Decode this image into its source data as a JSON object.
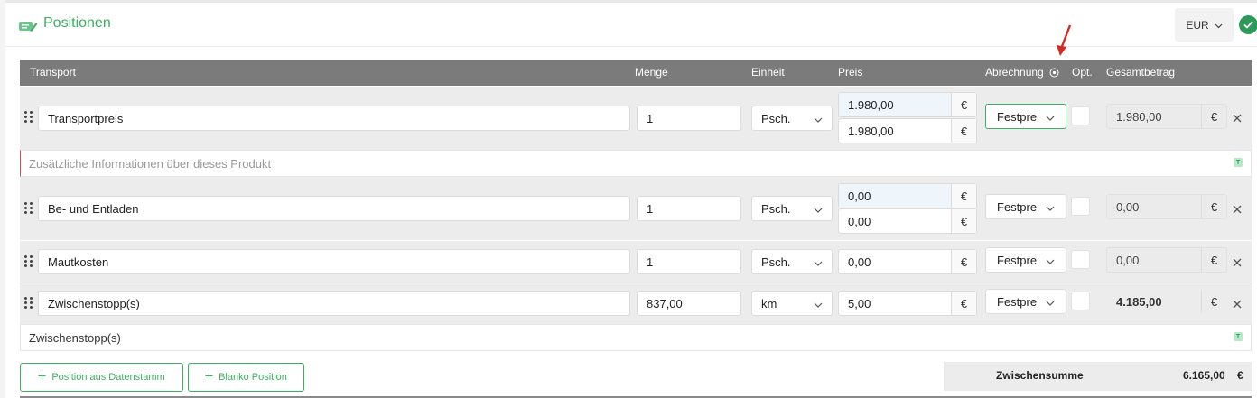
{
  "header": {
    "title": "Positionen",
    "currency": "EUR",
    "title_icon": "edit-list-icon",
    "status_icon": "check-icon",
    "accent_color": "#3fae62"
  },
  "columns": {
    "transport": "Transport",
    "menge": "Menge",
    "einheit": "Einheit",
    "preis": "Preis",
    "abrechnung": "Abrechnung",
    "opt": "Opt.",
    "gesamtbetrag": "Gesamtbetrag"
  },
  "rows": [
    {
      "name": "Transportpreis",
      "menge": "1",
      "einheit": "Psch.",
      "preis_a": "1.980,00",
      "preis_b": "1.980,00",
      "preis_cur_a": "€",
      "preis_cur_b": "€",
      "abrechnung": "Festpre",
      "total": "1.980,00",
      "total_cur": "€"
    },
    {
      "name": "Be- und Entladen",
      "menge": "1",
      "einheit": "Psch.",
      "preis_a": "0,00",
      "preis_b": "0,00",
      "preis_cur_a": "€",
      "preis_cur_b": "€",
      "abrechnung": "Festpre",
      "total": "0,00",
      "total_cur": "€"
    },
    {
      "name": "Mautkosten",
      "menge": "1",
      "einheit": "Psch.",
      "preis_a": "0,00",
      "preis_cur_a": "€",
      "abrechnung": "Festpre",
      "total": "0,00",
      "total_cur": "€"
    },
    {
      "name": "Zwischenstopp(s)",
      "menge": "837,00",
      "einheit": "km",
      "preis_a": "5,00",
      "preis_cur_a": "€",
      "abrechnung": "Festpre",
      "total": "4.185,00",
      "total_cur": "€"
    }
  ],
  "info_rows": [
    {
      "placeholder": "Zusätzliche Informationen über dieses Produkt",
      "badge": "T"
    },
    {
      "text": "Zwischenstopp(s)",
      "badge": "T"
    }
  ],
  "actions": {
    "add_from_master": "Position aus Datenstamm",
    "add_blank": "Blanko Position"
  },
  "summary": {
    "label": "Zwischensumme",
    "value": "6.165,00",
    "currency": "€"
  }
}
